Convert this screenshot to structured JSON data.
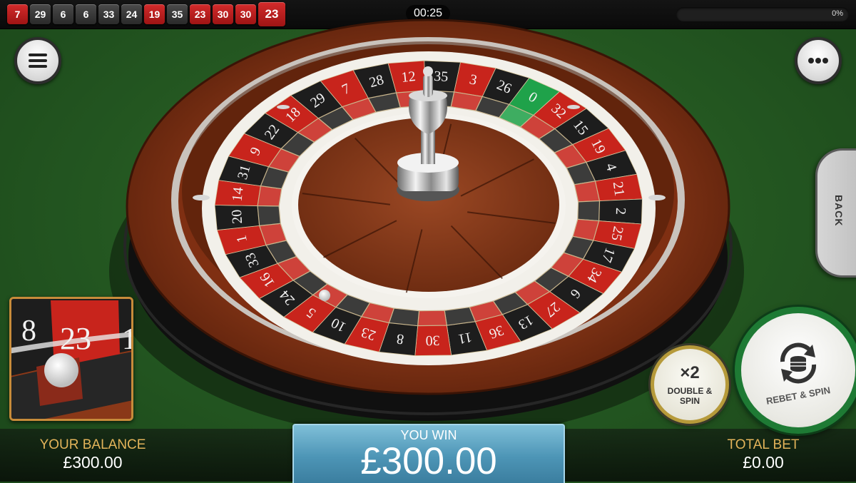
{
  "history": {
    "results": [
      {
        "number": "7",
        "color": "red"
      },
      {
        "number": "29",
        "color": "black"
      },
      {
        "number": "6",
        "color": "black"
      },
      {
        "number": "6",
        "color": "black"
      },
      {
        "number": "33",
        "color": "black"
      },
      {
        "number": "24",
        "color": "black"
      },
      {
        "number": "19",
        "color": "red"
      },
      {
        "number": "35",
        "color": "black"
      },
      {
        "number": "23",
        "color": "red"
      },
      {
        "number": "30",
        "color": "red"
      },
      {
        "number": "30",
        "color": "red"
      },
      {
        "number": "23",
        "color": "red"
      }
    ]
  },
  "timer": "00:25",
  "progress": {
    "label": "0%",
    "value": 0
  },
  "buttons": {
    "menu_icon": "hamburger-icon",
    "more_icon": "ellipsis-icon",
    "back": "BACK",
    "double_x2": "×2",
    "double_line1": "DOUBLE &",
    "double_line2": "SPIN",
    "rebet": "REBET & SPIN"
  },
  "wheel": {
    "numbers": [
      "0",
      "32",
      "15",
      "19",
      "4",
      "21",
      "2",
      "25",
      "17",
      "34",
      "6",
      "27",
      "13",
      "36",
      "11",
      "30",
      "8",
      "23",
      "10",
      "5",
      "24",
      "16",
      "33",
      "1",
      "20",
      "14",
      "31",
      "9",
      "22",
      "18",
      "29",
      "7",
      "28",
      "12",
      "35",
      "3",
      "26"
    ],
    "result": "23",
    "colors": {
      "red": "#c8241c",
      "black": "#1d1d1d",
      "green": "#1fa24a"
    }
  },
  "zoom": {
    "left_number": "8",
    "center_number": "23",
    "right_number": "1"
  },
  "balance": {
    "label": "YOUR BALANCE",
    "value": "£300.00"
  },
  "win": {
    "label": "YOU WIN",
    "value": "£300.00"
  },
  "total_bet": {
    "label": "TOTAL BET",
    "value": "£0.00"
  }
}
